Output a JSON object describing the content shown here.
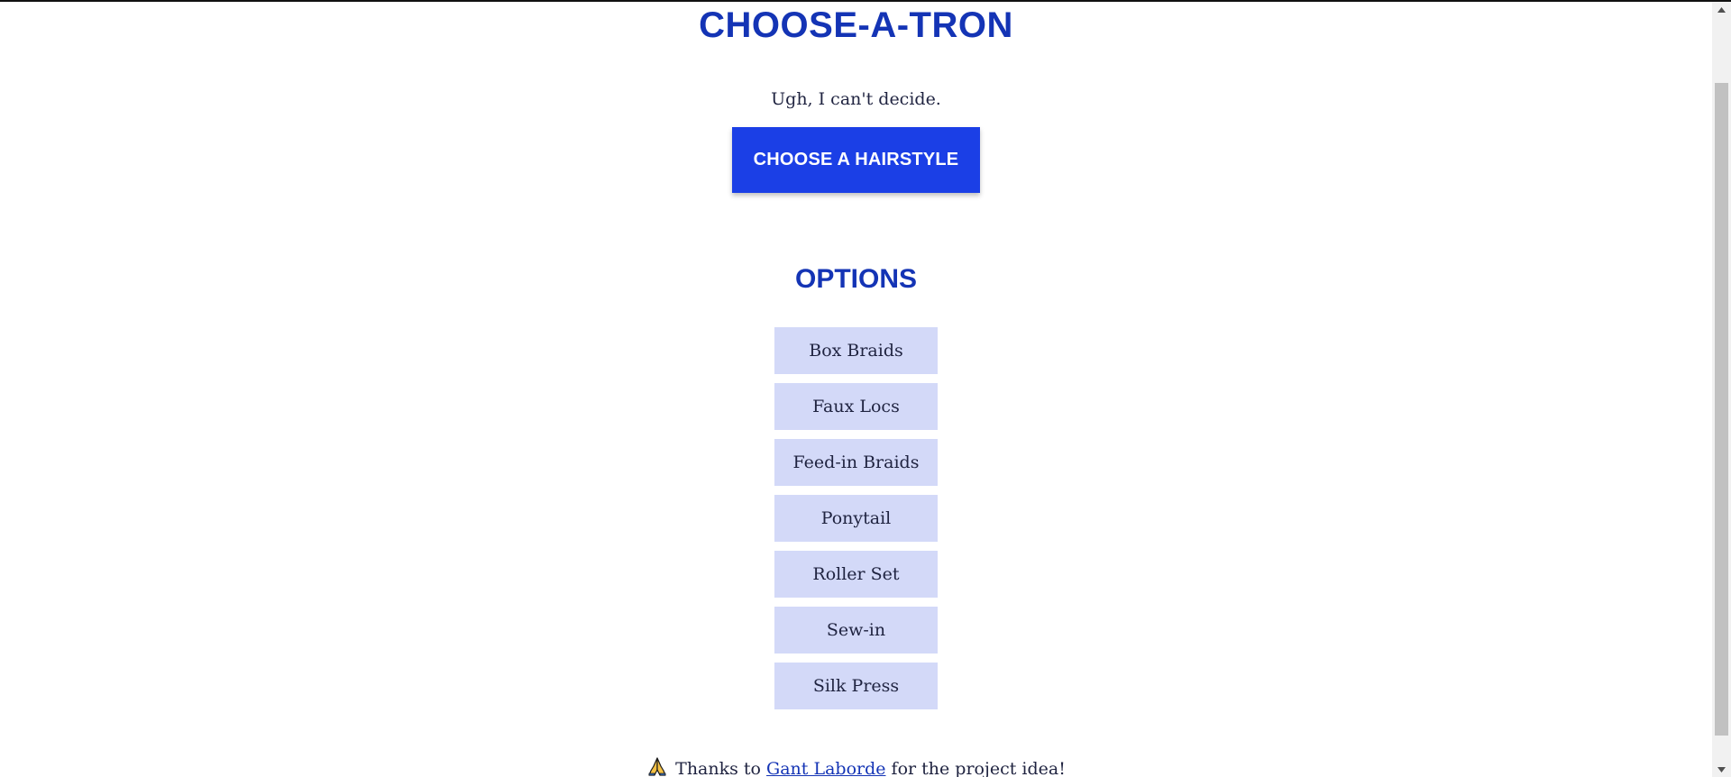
{
  "header": {
    "title": "CHOOSE-A-TRON",
    "subtitle": "Ugh, I can't decide."
  },
  "actions": {
    "choose_label": "CHOOSE A HAIRSTYLE"
  },
  "options": {
    "heading": "OPTIONS",
    "items": [
      {
        "label": "Box Braids"
      },
      {
        "label": "Faux Locs"
      },
      {
        "label": "Feed-in Braids"
      },
      {
        "label": "Ponytail"
      },
      {
        "label": "Roller Set"
      },
      {
        "label": "Sew-in"
      },
      {
        "label": "Silk Press"
      }
    ]
  },
  "footer": {
    "icon": "folded-hands-icon",
    "prefix": "Thanks to",
    "link_text": "Gant Laborde",
    "suffix": "for the project idea!"
  },
  "colors": {
    "heading": "#1434b5",
    "button_bg": "#1b3fe6",
    "option_bg": "#d3d9f8",
    "text": "#1f2340"
  }
}
